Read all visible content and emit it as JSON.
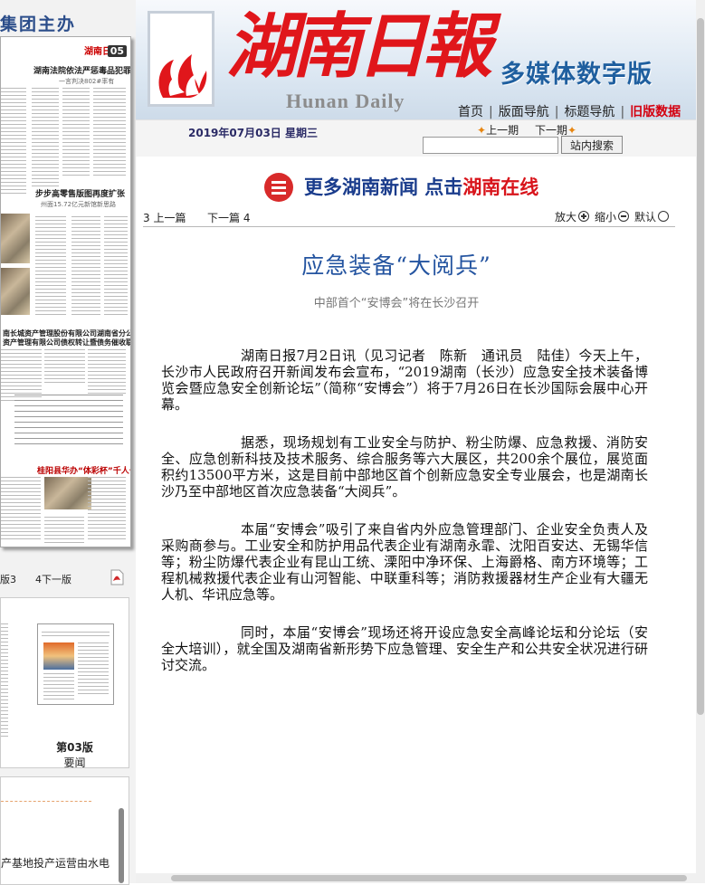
{
  "left_panel": {
    "group_title": "集团主办",
    "page_thumb": {
      "masthead": "湖南日报",
      "page_number": "05",
      "headline_1": "湖南法院依法严惩毒品犯罪",
      "sub_1": "一言判决802#率有",
      "headline_2": "步步高零售版图再度扩张",
      "sub_2": "州面15.72亿元新馆新思路",
      "headline_3": "南长城资产管理股份有限公司湖南省分公司",
      "headline_4": "资产管理有限公司债权转让暨债务催收联合公告",
      "headline_5": "桂阳县华办“体彩杯”千人长跑赛"
    },
    "pager": {
      "prev": "版3",
      "next": "4下一版"
    },
    "mini_page": {
      "number": "第03版",
      "label": "要闻"
    },
    "bottom_news": "产基地投产运营由水电"
  },
  "header": {
    "brand_title": "湖南日報",
    "brand_en": "Hunan Daily",
    "digital_edition": "多媒体数字版",
    "nav": {
      "home": "首页",
      "layout_nav": "版面导航",
      "title_nav": "标题导航",
      "old_data": "旧版数据",
      "sep": "|"
    }
  },
  "toolbar": {
    "date": "2019年07月03日",
    "weekday": "星期三",
    "prev_issue": "上一期",
    "next_issue": "下一期",
    "search_value": "",
    "search_button": "站内搜索"
  },
  "banner": {
    "text": "更多湖南新闻 点击",
    "link": "湖南在线"
  },
  "article_nav": {
    "prev": "3 上一篇",
    "next": "下一篇 4",
    "zoom_in": "放大",
    "zoom_out": "缩小",
    "reset": "默认"
  },
  "article": {
    "title": "应急装备“大阅兵”",
    "subtitle": "中部首个“安博会”将在长沙召开",
    "paragraphs": [
      "湖南日报7月2日讯（见习记者　陈新　通讯员　陆佳）今天上午，长沙市人民政府召开新闻发布会宣布，“2019湖南（长沙）应急安全技术装备博览会暨应急安全创新论坛”（简称“安博会”）将于7月26日在长沙国际会展中心开幕。",
      "据悉，现场规划有工业安全与防护、粉尘防爆、应急救援、消防安全、应急创新科技及技术服务、综合服务等六大展区，共200余个展位，展览面积约13500平方米，这是目前中部地区首个创新应急安全专业展会，也是湖南长沙乃至中部地区首次应急装备“大阅兵”。",
      "本届“安博会”吸引了来自省内外应急管理部门、企业安全负责人及采购商参与。工业安全和防护用品代表企业有湖南永霏、沈阳百安达、无锡华信等；粉尘防爆代表企业有昆山工统、溧阳中净环保、上海爵格、南方环境等；工程机械救援代表企业有山河智能、中联重科等；消防救援器材生产企业有大疆无人机、华讯应急等。",
      "同时，本届“安博会”现场还将开设应急安全高峰论坛和分论坛（安全大培训），就全国及湖南省新形势下应急管理、安全生产和公共安全状况进行研讨交流。"
    ]
  },
  "colors": {
    "brand_red": "#e0161b",
    "nav_blue": "#1f5f9f",
    "title_blue": "#2454a0",
    "old_data_red": "#d4000f"
  }
}
